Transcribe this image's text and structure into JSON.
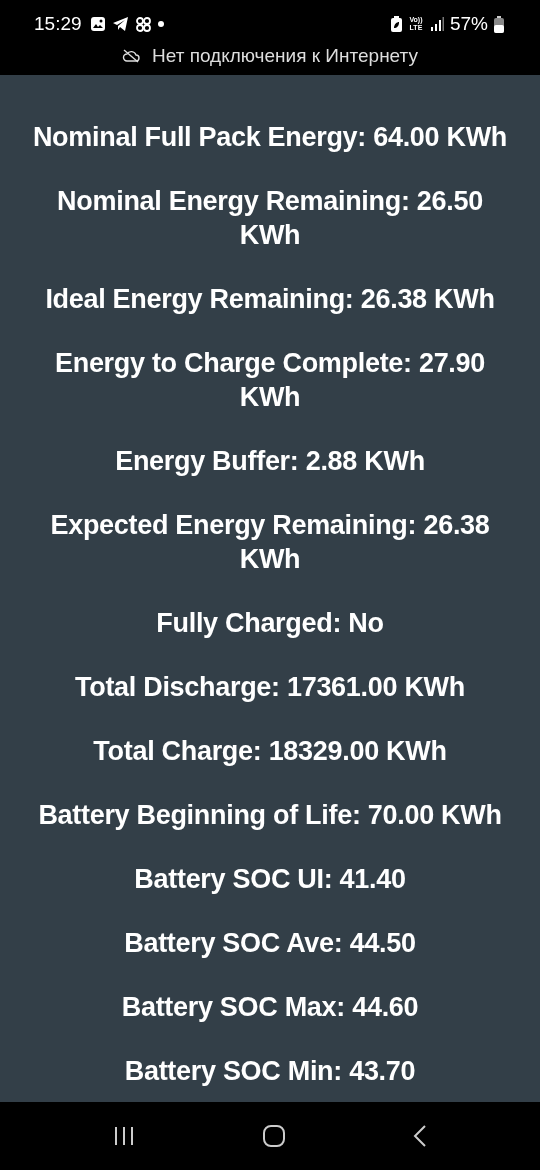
{
  "status_bar": {
    "time": "15:29",
    "battery": "57%",
    "network": "Vo)) LTE"
  },
  "banner": {
    "text": "Нет подключения к Интернету"
  },
  "readings": [
    {
      "text": "Nominal Full Pack Energy: 64.00 KWh"
    },
    {
      "text": "Nominal Energy Remaining: 26.50 KWh"
    },
    {
      "text": "Ideal Energy Remaining: 26.38 KWh"
    },
    {
      "text": "Energy to Charge Complete: 27.90 KWh"
    },
    {
      "text": "Energy Buffer: 2.88 KWh"
    },
    {
      "text": "Expected Energy Remaining: 26.38 KWh"
    },
    {
      "text": "Fully Charged: No"
    },
    {
      "text": "Total Discharge: 17361.00 KWh"
    },
    {
      "text": "Total Charge: 18329.00 KWh"
    },
    {
      "text": "Battery Beginning of Life: 70.00 KWh"
    },
    {
      "text": "Battery SOC UI: 41.40"
    },
    {
      "text": "Battery SOC Ave: 44.50"
    },
    {
      "text": "Battery SOC Max: 44.60"
    },
    {
      "text": "Battery SOC Min: 43.70"
    }
  ]
}
